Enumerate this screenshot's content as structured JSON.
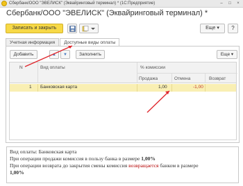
{
  "window": {
    "title": "Сбербанк/ООО \"ЭВЕЛИСК\" (Эквайринговый терминал) * (1С:Предприятие)",
    "minimize_glyph": "–",
    "maximize_glyph": "□",
    "close_glyph": "×"
  },
  "form": {
    "header": "Сбербанк/ООО \"ЭВЕЛИСК\" (Эквайринговый терминал) *"
  },
  "toolbar": {
    "save_close_label": "Записать и закрыть",
    "more_label": "Еще ▾",
    "help_label": "?"
  },
  "tabs": [
    {
      "label": "Учетная информация",
      "active": false
    },
    {
      "label": "Доступные виды оплаты",
      "active": true
    }
  ],
  "panel_toolbar": {
    "add_label": "Добавить",
    "up_label": "▲",
    "down_label": "▼",
    "fill_label": "Заполнить",
    "more_label": "Еще ▾"
  },
  "table": {
    "headers": {
      "n": "N",
      "vid": "Вид оплаты",
      "commission": "% комиссии",
      "sale": "Продажа",
      "cancel": "Отмена",
      "return": "Возврат"
    },
    "rows": [
      {
        "n": "1",
        "vid": "Банковская карта",
        "sale": "1,00",
        "cancel": "-1,00",
        "return": ""
      }
    ]
  },
  "footer": {
    "line1": "Вид оплаты: Банковская карта",
    "line2_prefix": "При операции продажи комиссия в пользу банка в размере ",
    "line2_value": "1,00%",
    "line3_prefix": "При операции возврата до закрытия смены комиссия ",
    "line3_red": "возвращается",
    "line3_suffix": " банком в размере",
    "line4_value": "1,00%"
  },
  "colors": {
    "accent_button": "#f7d947",
    "selected_row": "#f9efb3",
    "negative_value": "#c0392b",
    "annotation_arrow": "#e0282e"
  }
}
